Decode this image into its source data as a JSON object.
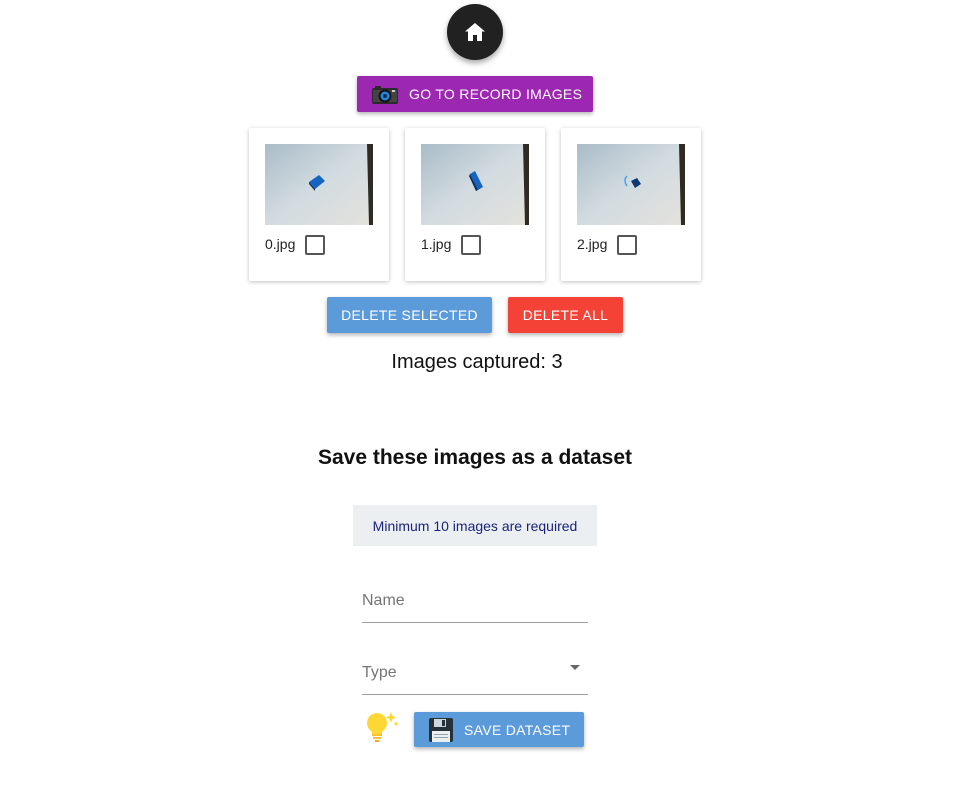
{
  "nav": {
    "home_icon": "home-icon"
  },
  "record": {
    "label": "GO TO RECORD IMAGES",
    "icon": "camera-icon",
    "color": "#9c27b0"
  },
  "images": [
    {
      "filename": "0.jpg",
      "checked": false
    },
    {
      "filename": "1.jpg",
      "checked": false
    },
    {
      "filename": "2.jpg",
      "checked": false
    }
  ],
  "actions": {
    "delete_selected_label": "DELETE SELECTED",
    "delete_all_label": "DELETE ALL",
    "delete_selected_color": "#5c9bd9",
    "delete_all_color": "#f44336"
  },
  "status": {
    "images_captured": "Images captured: 3"
  },
  "dataset": {
    "heading": "Save these images as a dataset",
    "notice": "Minimum 10 images are required",
    "name_label": "Name",
    "type_label": "Type",
    "hint_icon": "lightbulb-icon",
    "save_label": "SAVE DATASET",
    "save_icon": "floppy-disk-icon"
  }
}
